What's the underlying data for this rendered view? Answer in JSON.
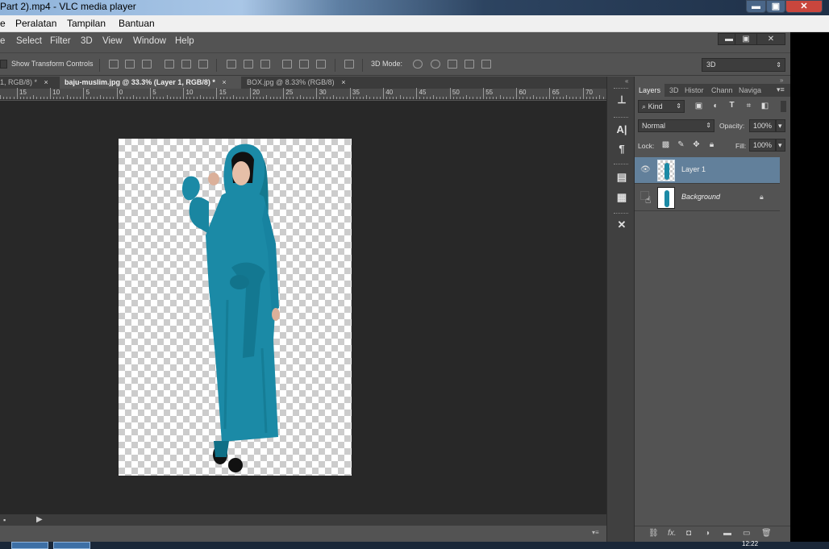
{
  "vlc": {
    "title": "Part 2).mp4 - VLC media player",
    "menu": [
      "e",
      "Peralatan",
      "Tampilan",
      "Bantuan"
    ],
    "window_buttons": {
      "minimize": "▬",
      "maximize": "▣",
      "close": "✕"
    }
  },
  "photoshop": {
    "menu": [
      "e",
      "Select",
      "Filter",
      "3D",
      "View",
      "Window",
      "Help"
    ],
    "window_controls": {
      "minimize": "▬",
      "restore": "▣",
      "close": "✕"
    },
    "options_bar": {
      "show_transform_controls": "Show Transform Controls",
      "mode_label": "3D Mode:",
      "workspace": "3D"
    },
    "document_tabs": [
      {
        "label": "1, RGB/8) *",
        "close": "×",
        "active": false
      },
      {
        "label": "baju-muslim.jpg @ 33.3% (Layer 1, RGB/8) *",
        "close": "×",
        "active": true
      },
      {
        "label": "BOX.jpg @ 8.33% (RGB/8)",
        "close": "×",
        "active": false
      }
    ],
    "ruler_labels": [
      "15",
      "10",
      "5",
      "0",
      "5",
      "10",
      "15",
      "20",
      "25",
      "30",
      "35",
      "40",
      "45",
      "50",
      "55",
      "60",
      "65",
      "70"
    ]
  },
  "layers_panel": {
    "tabs": [
      "Layers",
      "3D",
      "Histor",
      "Chann",
      "Naviga"
    ],
    "filter_kind": "Kind",
    "blend_mode": "Normal",
    "opacity_label": "Opacity:",
    "opacity_value": "100%",
    "lock_label": "Lock:",
    "fill_label": "Fill:",
    "fill_value": "100%",
    "layers": [
      {
        "name": "Layer 1",
        "visible": true,
        "selected": true
      },
      {
        "name": "Background",
        "visible": false,
        "locked": true
      }
    ],
    "footer_icons": [
      "link-icon",
      "fx-icon",
      "mask-icon",
      "adjustment-icon",
      "folder-icon",
      "new-layer-icon",
      "trash-icon"
    ]
  },
  "taskbar": {
    "time": "12:22"
  },
  "colors": {
    "dress": "#1b8aa6",
    "selected_layer": "#62809b",
    "canvas_bg": "#282828"
  }
}
